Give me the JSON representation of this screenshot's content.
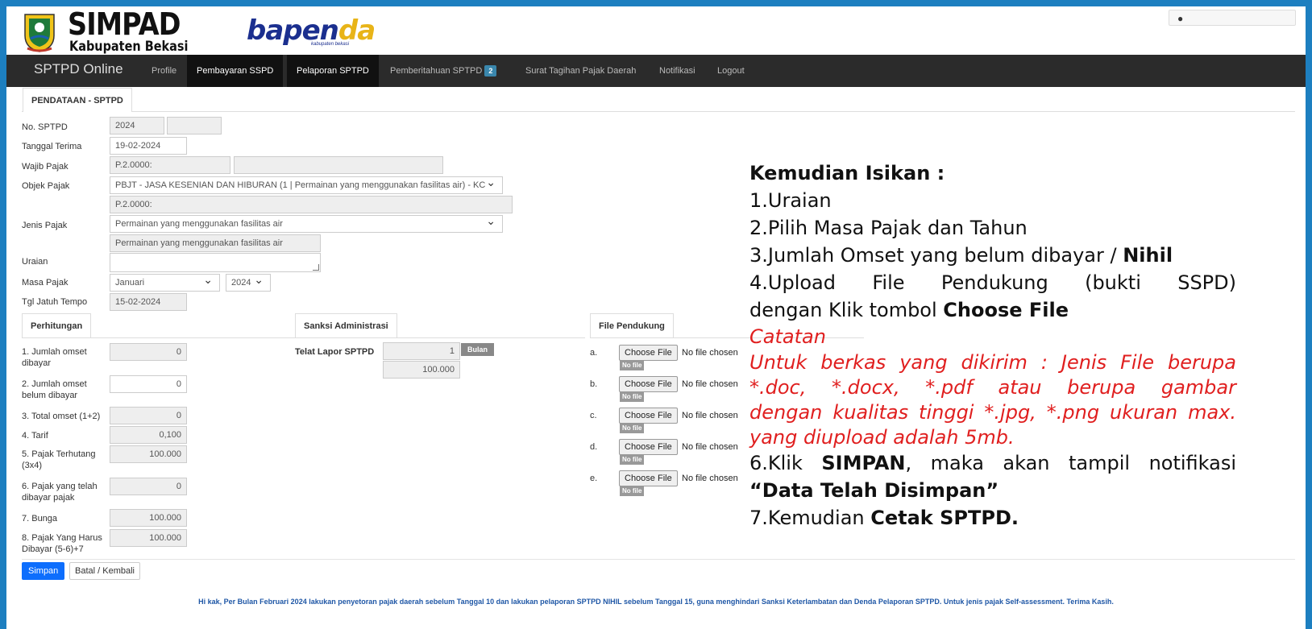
{
  "header": {
    "logo_title": "SIMPAD",
    "logo_subtitle": "Kabupaten Bekasi",
    "bapenda_main": "bapen",
    "bapenda_accent": "da",
    "bapenda_sub": "kabupaten bekasi"
  },
  "nav": {
    "brand": "SPTPD Online",
    "items": [
      "Profile",
      "Pembayaran SSPD",
      "Pelaporan SPTPD",
      "Pemberitahuan SPTPD",
      "Surat Tagihan Pajak Daerah",
      "Notifikasi",
      "Logout"
    ],
    "badge_count": "2"
  },
  "tabs": {
    "main": "PENDATAAN - SPTPD",
    "perhitungan": "Perhitungan",
    "sanksi": "Sanksi Administrasi",
    "file": "File Pendukung"
  },
  "form": {
    "labels": {
      "no_sptpd": "No. SPTPD",
      "tanggal_terima": "Tanggal Terima",
      "wajib_pajak": "Wajib Pajak",
      "objek_pajak": "Objek Pajak",
      "jenis_pajak": "Jenis Pajak",
      "uraian": "Uraian",
      "masa_pajak": "Masa Pajak",
      "tgl_jatuh_tempo": "Tgl Jatuh Tempo"
    },
    "values": {
      "no_sptpd_year": "2024",
      "no_sptpd_num": "",
      "tanggal_terima": "19-02-2024",
      "wajib_pajak_code": "P.2.0000:",
      "wajib_pajak_name": "",
      "objek_pajak": "PBJT - JASA KESENIAN DAN HIBURAN (1 | Permainan yang menggunakan fasilitas air) - KC",
      "objek_pajak_code": "P.2.0000:",
      "jenis_pajak": "Permainan yang menggunakan fasilitas air",
      "jenis_pajak_desc": "Permainan yang menggunakan fasilitas air",
      "uraian": "",
      "masa_bulan": "Januari",
      "masa_tahun": "2024",
      "tgl_jatuh_tempo": "15-02-2024"
    }
  },
  "perhitungan": {
    "labels": [
      "1. Jumlah omset dibayar",
      "2. Jumlah omset belum dibayar",
      "3. Total omset (1+2)",
      "4. Tarif",
      "5. Pajak Terhutang (3x4)",
      "6. Pajak yang telah dibayar pajak",
      "7. Bunga",
      "8. Pajak Yang Harus Dibayar (5-6)+7"
    ],
    "values": [
      "0",
      "0",
      "0",
      "0,100",
      "100.000",
      "0",
      "100.000",
      "100.000"
    ]
  },
  "sanksi": {
    "label": "Telat Lapor SPTPD",
    "months": "1",
    "unit": "Bulan",
    "amount": "100.000"
  },
  "files": {
    "letters": [
      "a.",
      "b.",
      "c.",
      "d.",
      "e."
    ],
    "choose_label": "Choose File",
    "no_file_chosen": "No file chosen",
    "no_file_badge": "No file"
  },
  "buttons": {
    "save": "Simpan",
    "back": "Batal / Kembali"
  },
  "footer": "Hi kak, Per Bulan Februari 2024 lakukan penyetoran pajak daerah sebelum Tanggal 10 dan lakukan pelaporan SPTPD NIHIL sebelum Tanggal 15, guna menghindari Sanksi Keterlambatan dan Denda Pelaporan SPTPD. Untuk jenis pajak Self-assessment. Terima Kasih.",
  "instructions": {
    "title": "Kemudian Isikan :",
    "s1": "1.Uraian",
    "s2": "2.Pilih Masa Pajak dan Tahun",
    "s3_a": "3.Jumlah Omset yang belum dibayar / ",
    "s3_b": "Nihil",
    "s4_line1": "4.Upload File Pendukung (bukti SSPD)",
    "s4_line2_a": "dengan Klik tombol ",
    "s4_line2_b": "Choose File",
    "catatan": "Catatan",
    "note_l1": "Untuk berkas yang dikirim : Jenis File berupa",
    "note_l2": "*.doc, *.docx, *.pdf atau berupa gambar",
    "note_l3": "dengan kualitas tinggi *.jpg, *.png ukuran max.",
    "note_l4": "yang diupload adalah 5mb.",
    "s6_a": "6.Klik ",
    "s6_b": "SIMPAN",
    "s6_c": ", maka akan tampil notifikasi",
    "s6_d": "“Data Telah Disimpan”",
    "s7_a": "7.Kemudian ",
    "s7_b": "Cetak SPTPD."
  }
}
